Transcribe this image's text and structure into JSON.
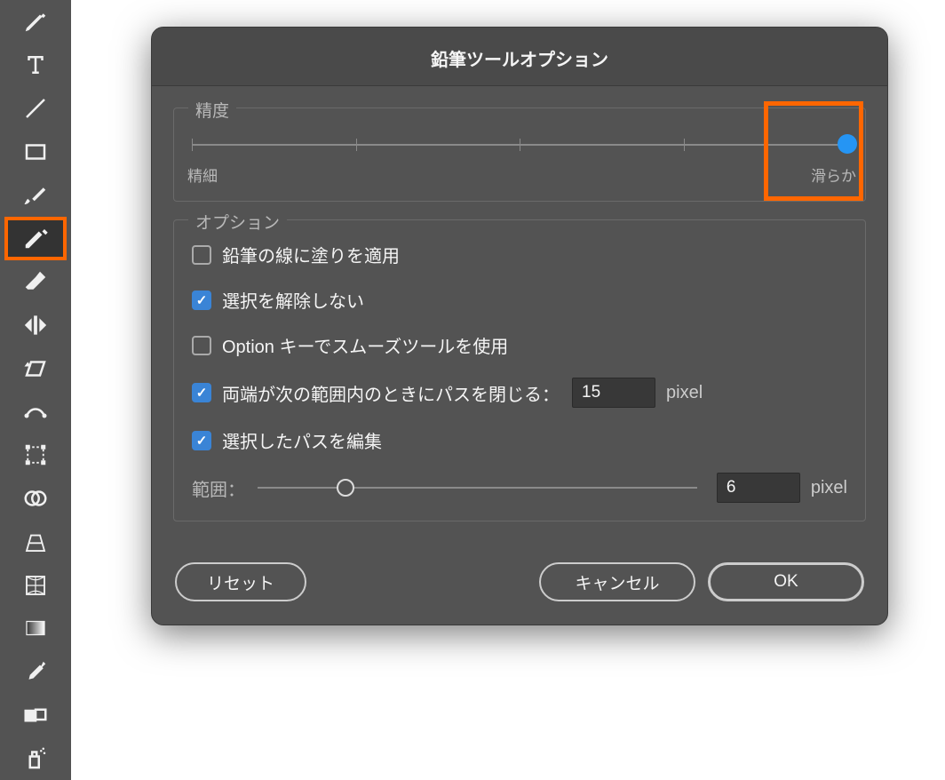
{
  "dialog": {
    "title": "鉛筆ツールオプション",
    "accuracy": {
      "group_label": "精度",
      "left_label": "精細",
      "right_label": "滑らか",
      "value_percent": 100,
      "ticks_percent": [
        0,
        25,
        50,
        75,
        100
      ]
    },
    "options": {
      "group_label": "オプション",
      "fill_new_strokes": {
        "label": "鉛筆の線に塗りを適用",
        "checked": false
      },
      "keep_selected": {
        "label": "選択を解除しない",
        "checked": true
      },
      "option_smooth": {
        "label": "Option キーでスムーズツールを使用",
        "checked": false
      },
      "close_paths": {
        "label": "両端が次の範囲内のときにパスを閉じる：",
        "checked": true,
        "value": "15",
        "unit": "pixel"
      },
      "edit_selected": {
        "label": "選択したパスを編集",
        "checked": true
      },
      "within_range": {
        "label": "範囲：",
        "value": "6",
        "unit": "pixel",
        "slider_percent": 20
      }
    },
    "buttons": {
      "reset": "リセット",
      "cancel": "キャンセル",
      "ok": "OK"
    }
  },
  "toolbar": {
    "items": [
      {
        "name": "pen-tool-icon"
      },
      {
        "name": "type-tool-icon"
      },
      {
        "name": "line-tool-icon"
      },
      {
        "name": "rectangle-tool-icon"
      },
      {
        "name": "brush-tool-icon"
      },
      {
        "name": "pencil-tool-icon",
        "selected": true,
        "highlighted": true
      },
      {
        "name": "eraser-tool-icon"
      },
      {
        "name": "reflect-tool-icon"
      },
      {
        "name": "shear-tool-icon"
      },
      {
        "name": "width-tool-icon"
      },
      {
        "name": "free-transform-tool-icon"
      },
      {
        "name": "shape-builder-tool-icon"
      },
      {
        "name": "perspective-tool-icon"
      },
      {
        "name": "mesh-tool-icon"
      },
      {
        "name": "gradient-tool-icon"
      },
      {
        "name": "eyedropper-tool-icon"
      },
      {
        "name": "blend-tool-icon"
      },
      {
        "name": "symbol-spray-tool-icon"
      }
    ]
  }
}
